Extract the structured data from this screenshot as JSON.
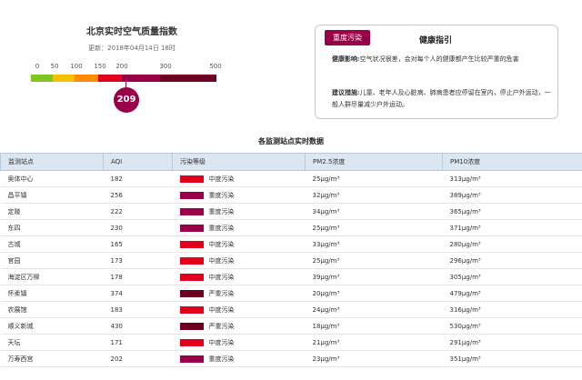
{
  "aqi_panel": {
    "title": "北京实时空气质量指数",
    "update_time": "更新：2018年04月14日 18时",
    "scale_labels": [
      "0",
      "50",
      "100",
      "150",
      "200",
      "300",
      "500"
    ],
    "scale_colors": [
      "#7ec51f",
      "#f5c200",
      "#ff8a00",
      "#e0001c",
      "#9a004a",
      "#6b0021"
    ],
    "current_aqi": "209",
    "marker_color": "#9a004a"
  },
  "health": {
    "badge": "重度污染",
    "title": "健康指引",
    "impact_label": "健康影响:",
    "impact_text": "空气状况很差，会对每个人的健康都产生比较严重的危害",
    "advice_label": "建议措施:",
    "advice_text": "儿童、老年人及心脏病、肺病患者应停留在室内，停止户外运动，一般人群尽量减少户外运动。"
  },
  "table": {
    "title": "各监测站点实时数据",
    "headers": [
      "监测站点",
      "AQI",
      "污染等级",
      "PM2.5浓度",
      "PM10浓度"
    ],
    "rows": [
      {
        "station": "奥体中心",
        "aqi": "182",
        "level": "中度污染",
        "color": "#e0001c",
        "pm25": "25μg/m³",
        "pm10": "313μg/m³"
      },
      {
        "station": "昌平镇",
        "aqi": "256",
        "level": "重度污染",
        "color": "#9a004a",
        "pm25": "32μg/m³",
        "pm10": "389μg/m³"
      },
      {
        "station": "定陵",
        "aqi": "222",
        "level": "重度污染",
        "color": "#9a004a",
        "pm25": "34μg/m³",
        "pm10": "365μg/m³"
      },
      {
        "station": "东四",
        "aqi": "230",
        "level": "重度污染",
        "color": "#9a004a",
        "pm25": "25μg/m³",
        "pm10": "371μg/m³"
      },
      {
        "station": "古城",
        "aqi": "165",
        "level": "中度污染",
        "color": "#e0001c",
        "pm25": "33μg/m³",
        "pm10": "280μg/m³"
      },
      {
        "station": "官园",
        "aqi": "173",
        "level": "中度污染",
        "color": "#e0001c",
        "pm25": "25μg/m³",
        "pm10": "296μg/m³"
      },
      {
        "station": "海淀区万柳",
        "aqi": "178",
        "level": "中度污染",
        "color": "#e0001c",
        "pm25": "39μg/m³",
        "pm10": "305μg/m³"
      },
      {
        "station": "怀柔镇",
        "aqi": "374",
        "level": "严重污染",
        "color": "#6b0021",
        "pm25": "20μg/m³",
        "pm10": "479μg/m³"
      },
      {
        "station": "农展馆",
        "aqi": "183",
        "level": "中度污染",
        "color": "#e0001c",
        "pm25": "24μg/m³",
        "pm10": "316μg/m³"
      },
      {
        "station": "顺义新城",
        "aqi": "430",
        "level": "严重污染",
        "color": "#6b0021",
        "pm25": "18μg/m³",
        "pm10": "530μg/m³"
      },
      {
        "station": "天坛",
        "aqi": "171",
        "level": "中度污染",
        "color": "#e0001c",
        "pm25": "21μg/m³",
        "pm10": "291μg/m³"
      },
      {
        "station": "万寿西宫",
        "aqi": "202",
        "level": "重度污染",
        "color": "#9a004a",
        "pm25": "23μg/m³",
        "pm10": "351μg/m³"
      }
    ]
  }
}
